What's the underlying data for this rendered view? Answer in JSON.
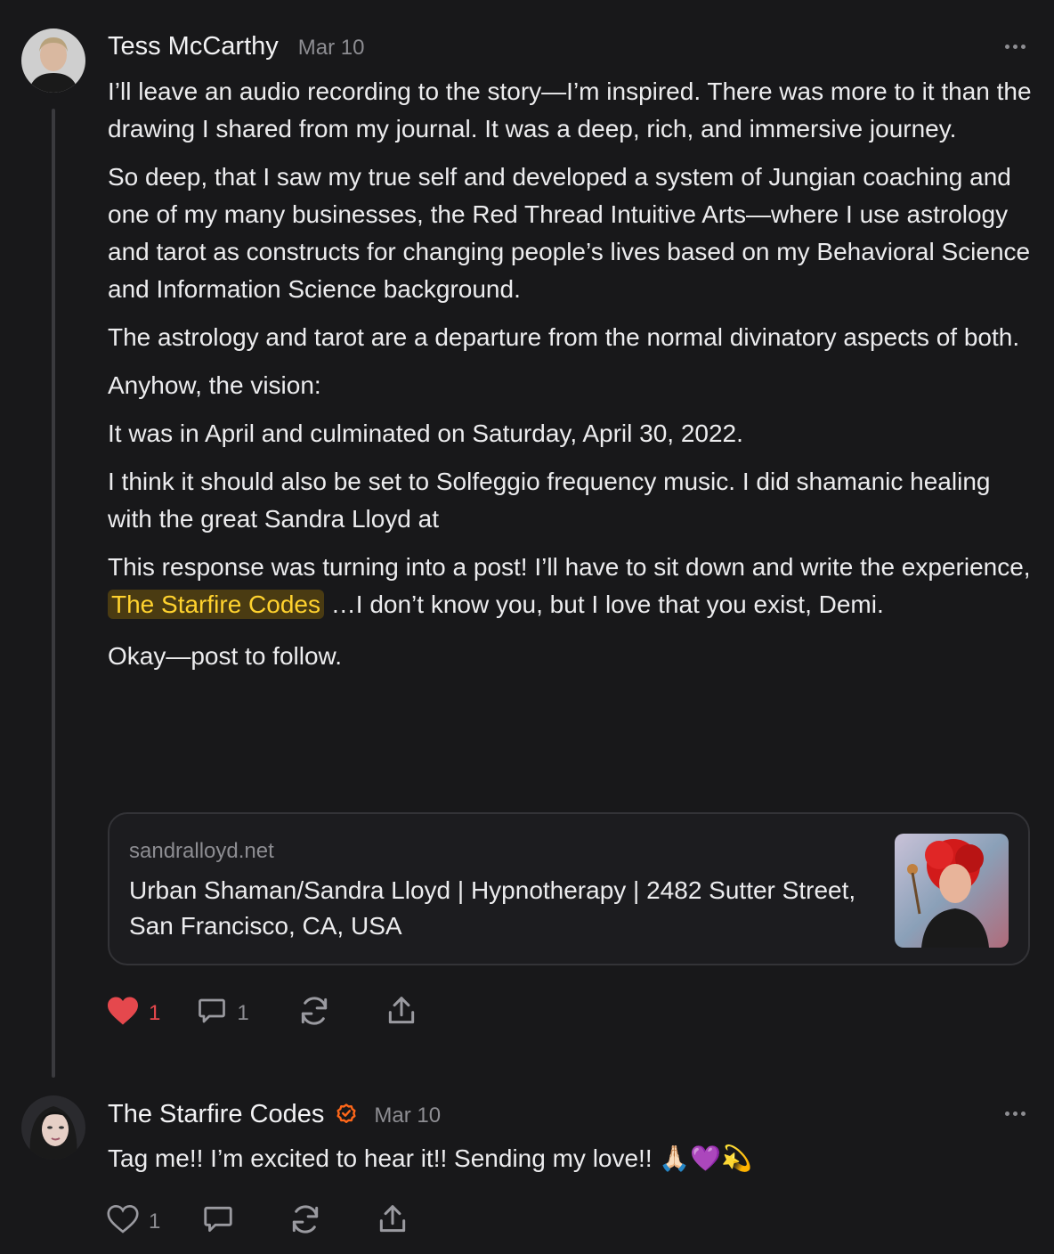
{
  "posts": [
    {
      "author": "Tess McCarthy",
      "date": "Mar 10",
      "paragraphs": [
        "I’ll leave an audio recording to the story—I’m inspired. There was more to it than the drawing I shared from my journal. It was a deep, rich, and immersive journey.",
        "So deep, that I saw my true self and developed a system of Jungian coaching and one of my many businesses, the Red Thread Intuitive Arts—where I use astrology and tarot as constructs for changing people’s lives based on my Behavioral Science and Information Science background.",
        "The astrology and tarot are a departure from the normal divinatory aspects of both.",
        "Anyhow, the vision:",
        "It was in April and culminated on Saturday, April 30, 2022.",
        "I think it should also be set to Solfeggio frequency music. I did shamanic healing with the great Sandra Lloyd at"
      ],
      "mention_before": "This response was turning into a post! I’ll have to sit down and write the experience, ",
      "mention": "The Starfire Codes",
      "mention_after": " …I don’t know you, but I love that you exist, Demi.",
      "closing": "Okay—post to follow.",
      "link_card": {
        "domain": "sandralloyd.net",
        "title": "Urban Shaman/Sandra Lloyd | Hypnotherapy | 2482 Sutter Street, San Francisco, CA, USA"
      },
      "likes": "1",
      "comments": "1",
      "liked": true
    },
    {
      "author": "The Starfire Codes",
      "date": "Mar 10",
      "verified": true,
      "text": "Tag me!! I’m excited to hear it!! Sending my love!! 🙏🏻💜💫",
      "likes": "1"
    }
  ],
  "colors": {
    "background": "#18181a",
    "mention_bg": "#4a3b12",
    "mention_text": "#ffd22e",
    "like_red": "#e5484d",
    "verified_orange": "#ff6719"
  },
  "icons": [
    "heart-icon",
    "comment-icon",
    "restack-icon",
    "share-icon",
    "more-icon",
    "verified-check-icon"
  ]
}
